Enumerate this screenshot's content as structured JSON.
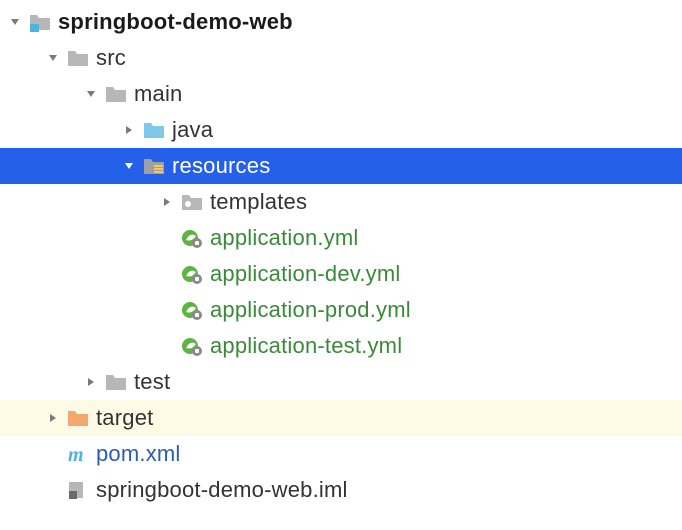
{
  "tree": {
    "root": {
      "name": "springboot-demo-web",
      "module_badge": true
    },
    "src": {
      "label": "src"
    },
    "main": {
      "label": "main"
    },
    "java": {
      "label": "java"
    },
    "resources": {
      "label": "resources"
    },
    "templates": {
      "label": "templates"
    },
    "files": {
      "app_yml": {
        "label": "application.yml"
      },
      "app_dev": {
        "label": "application-dev.yml"
      },
      "app_prod": {
        "label": "application-prod.yml"
      },
      "app_test": {
        "label": "application-test.yml"
      }
    },
    "test": {
      "label": "test"
    },
    "target": {
      "label": "target"
    },
    "pom": {
      "label": "pom.xml"
    },
    "iml": {
      "label": "springboot-demo-web.iml"
    }
  },
  "colors": {
    "selection": "#2460e8",
    "highlight": "#fdfae6",
    "folder_gray": "#b7b7b7",
    "folder_blue": "#7fc9e8",
    "folder_orange": "#f5a86e",
    "link": "#2a5db0",
    "green": "#3a8a3a"
  }
}
